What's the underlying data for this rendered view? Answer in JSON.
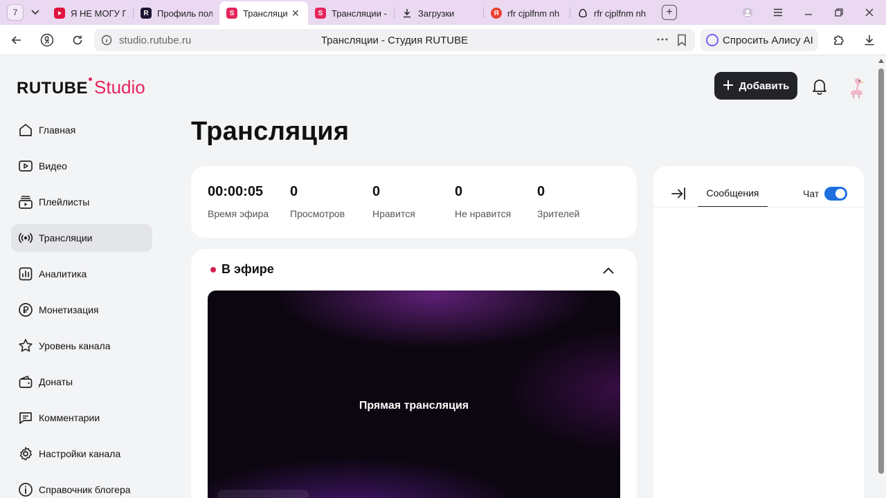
{
  "browser": {
    "tab_counter": "7",
    "tabs": [
      {
        "label": "Я НЕ МОГУ П",
        "favicon": "youtube-icon",
        "color": "#e0143c"
      },
      {
        "label": "Профиль пол",
        "favicon": "rutube-icon",
        "color": "#1e1533"
      },
      {
        "label": "Трансляции",
        "favicon": "rutube-studio-icon",
        "color": "#e5245b",
        "active": true
      },
      {
        "label": "Трансляции -",
        "favicon": "rutube-studio-icon",
        "color": "#e5245b"
      },
      {
        "label": "Загрузки",
        "favicon": "download-icon",
        "color": "#333333"
      },
      {
        "label": "rfr cjplfnm nh",
        "favicon": "yandex-icon",
        "color": "#e8412f"
      },
      {
        "label": "rfr cjplfnm nh",
        "favicon": "alice-icon",
        "color": "#222222"
      }
    ],
    "url_host": "studio.rutube.ru",
    "page_title": "Трансляции - Студия RUTUBE",
    "alice_label": "Спросить Алису AI"
  },
  "header": {
    "logo_main": "RUTUBE",
    "logo_suffix": "Studio",
    "add_label": "Добавить",
    "brand_color": "#e5245b"
  },
  "sidebar": {
    "items": [
      {
        "label": "Главная",
        "icon": "home-icon"
      },
      {
        "label": "Видео",
        "icon": "video-icon"
      },
      {
        "label": "Плейлисты",
        "icon": "playlist-icon"
      },
      {
        "label": "Трансляции",
        "icon": "broadcast-icon",
        "active": true
      },
      {
        "label": "Аналитика",
        "icon": "analytics-icon"
      },
      {
        "label": "Монетизация",
        "icon": "ruble-icon"
      },
      {
        "label": "Уровень канала",
        "icon": "star-icon"
      },
      {
        "label": "Донаты",
        "icon": "wallet-icon"
      },
      {
        "label": "Комментарии",
        "icon": "comment-icon"
      },
      {
        "label": "Настройки канала",
        "icon": "gear-icon"
      },
      {
        "label": "Справочник блогера",
        "icon": "info-icon"
      }
    ]
  },
  "main": {
    "title": "Трансляция",
    "stats": [
      {
        "value": "00:00:05",
        "label": "Время эфира"
      },
      {
        "value": "0",
        "label": "Просмотров"
      },
      {
        "value": "0",
        "label": "Нравится"
      },
      {
        "value": "0",
        "label": "Не нравится"
      },
      {
        "value": "0",
        "label": "Зрителей"
      }
    ],
    "live_label": "В эфире",
    "player_text": "Прямая трансляция",
    "live_dot_color": "#d3204f"
  },
  "chat": {
    "tab_messages": "Сообщения",
    "toggle_label": "Чат",
    "toggle_on": true,
    "toggle_color": "#1f6fe0"
  }
}
